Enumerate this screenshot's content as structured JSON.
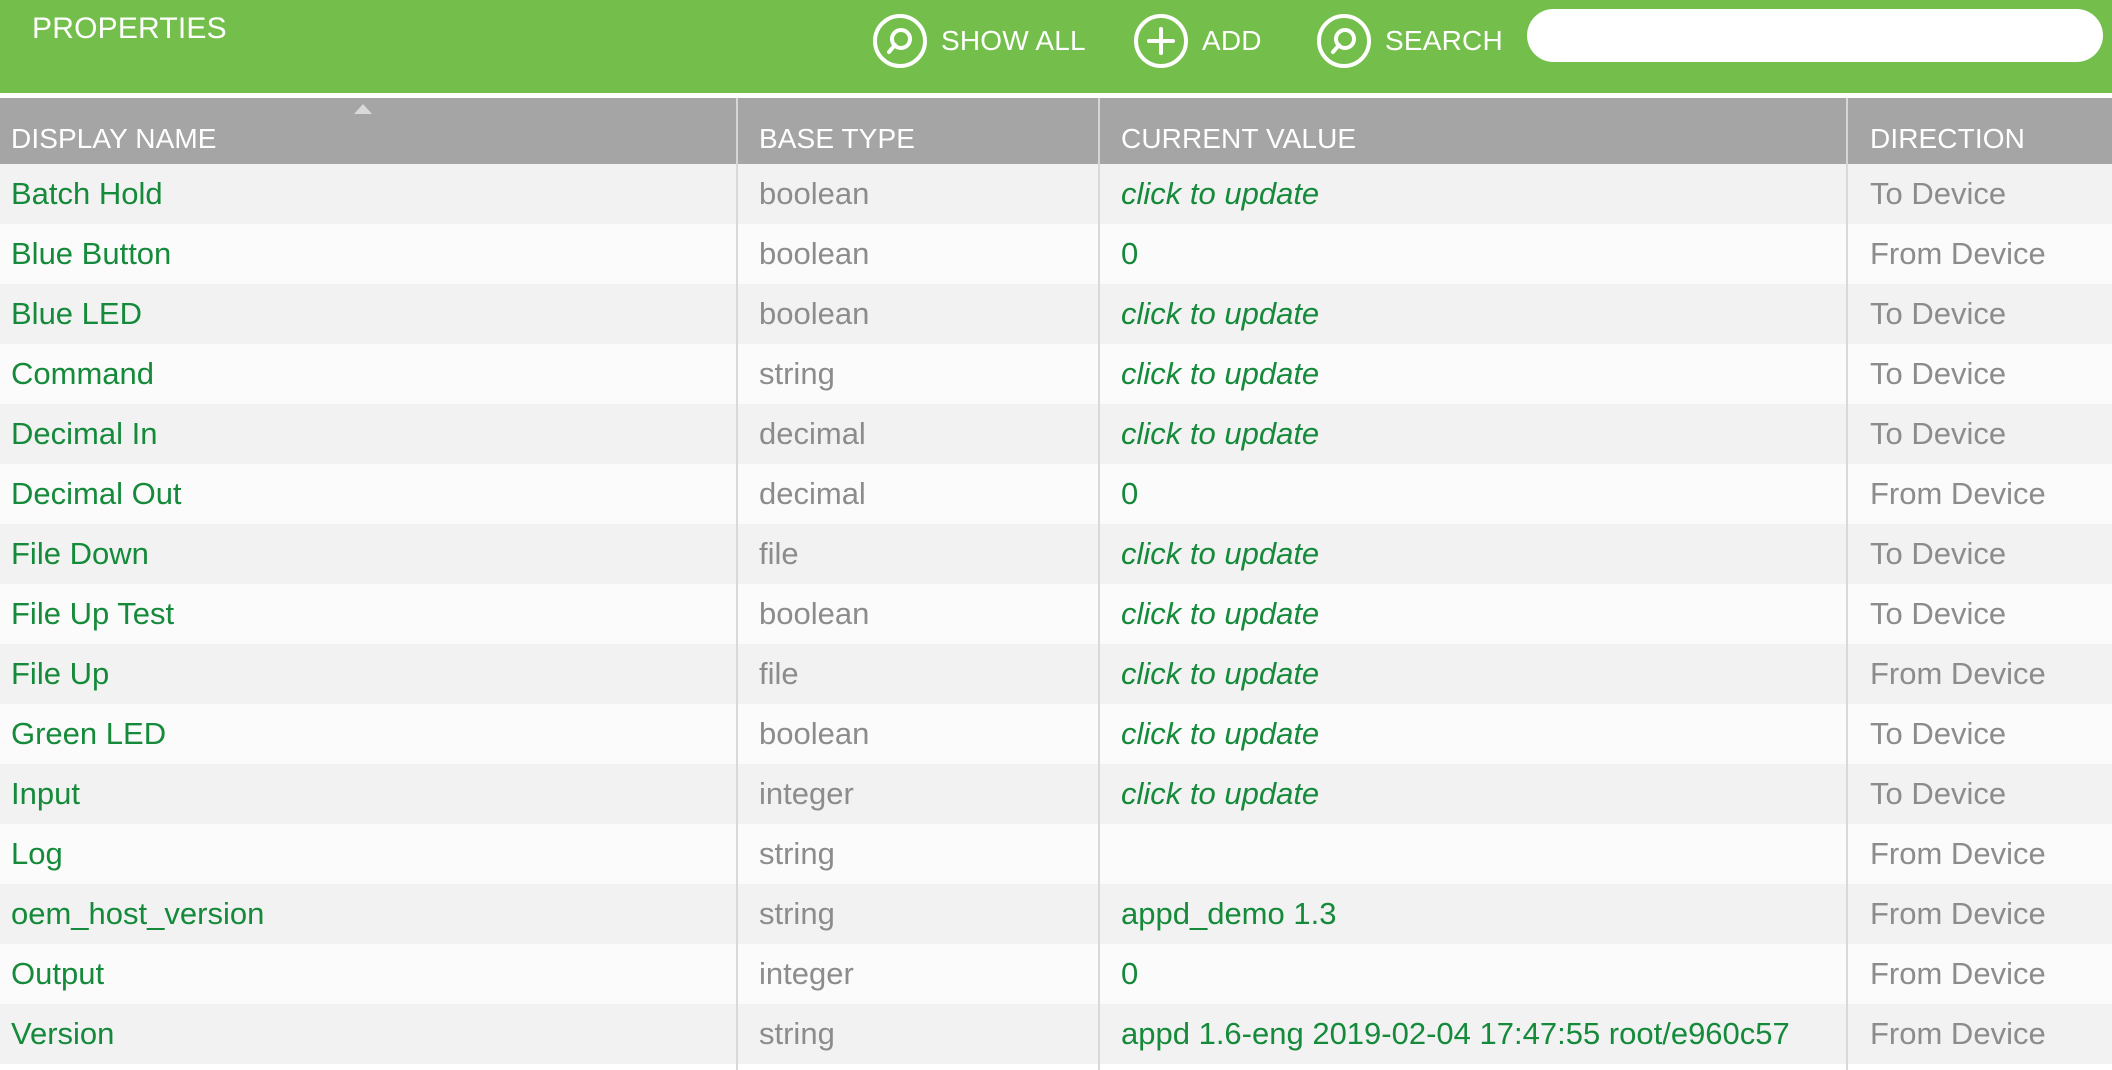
{
  "toolbar": {
    "title": "PROPERTIES",
    "show_all_label": "SHOW ALL",
    "add_label": "ADD",
    "search_label": "SEARCH",
    "search_value": "",
    "accent_color": "#74bf4b"
  },
  "table": {
    "headers": {
      "display_name": "DISPLAY NAME",
      "base_type": "BASE TYPE",
      "current_value": "CURRENT VALUE",
      "direction": "DIRECTION"
    },
    "sort": {
      "column": "display_name",
      "order": "ascending"
    },
    "rows": [
      {
        "name": "Batch Hold",
        "type": "boolean",
        "value": "click to update",
        "direction": "To Device"
      },
      {
        "name": "Blue Button",
        "type": "boolean",
        "value": "0",
        "direction": "From Device"
      },
      {
        "name": "Blue LED",
        "type": "boolean",
        "value": "click to update",
        "direction": "To Device"
      },
      {
        "name": "Command",
        "type": "string",
        "value": "click to update",
        "direction": "To Device"
      },
      {
        "name": "Decimal In",
        "type": "decimal",
        "value": "click to update",
        "direction": "To Device"
      },
      {
        "name": "Decimal Out",
        "type": "decimal",
        "value": "0",
        "direction": "From Device"
      },
      {
        "name": "File Down",
        "type": "file",
        "value": "click to update",
        "direction": "To Device"
      },
      {
        "name": "File Up Test",
        "type": "boolean",
        "value": "click to update",
        "direction": "To Device"
      },
      {
        "name": "File Up",
        "type": "file",
        "value": "click to update",
        "direction": "From Device"
      },
      {
        "name": "Green LED",
        "type": "boolean",
        "value": "click to update",
        "direction": "To Device"
      },
      {
        "name": "Input",
        "type": "integer",
        "value": "click to update",
        "direction": "To Device"
      },
      {
        "name": "Log",
        "type": "string",
        "value": "",
        "direction": "From Device"
      },
      {
        "name": "oem_host_version",
        "type": "string",
        "value": "appd_demo 1.3",
        "direction": "From Device"
      },
      {
        "name": "Output",
        "type": "integer",
        "value": "0",
        "direction": "From Device"
      },
      {
        "name": "Version",
        "type": "string",
        "value": "appd 1.6-eng 2019-02-04 17:47:55 root/e960c57",
        "direction": "From Device"
      }
    ]
  }
}
